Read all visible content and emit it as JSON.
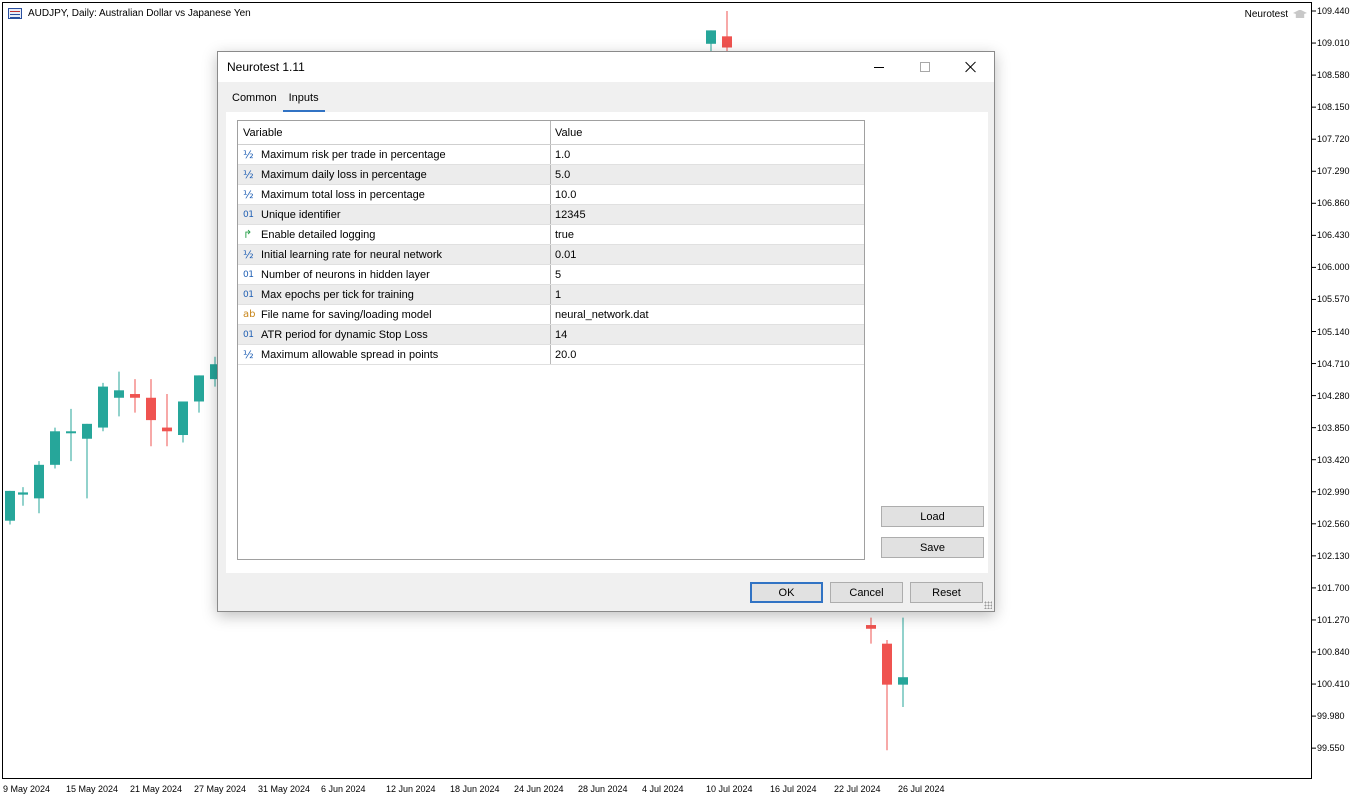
{
  "chart": {
    "title": "AUDJPY, Daily:  Australian Dollar vs Japanese Yen",
    "ea_name": "Neurotest",
    "ea_icon": "graduation-cap-icon",
    "colors": {
      "bull": "#26a69a",
      "bear": "#ef5350",
      "frame": "#000000"
    }
  },
  "chart_data": {
    "type": "candlestick",
    "y_ticks": [
      "109.440",
      "109.010",
      "108.580",
      "108.150",
      "107.720",
      "107.290",
      "106.860",
      "106.430",
      "106.000",
      "105.570",
      "105.140",
      "104.710",
      "104.280",
      "103.850",
      "103.420",
      "102.990",
      "102.560",
      "102.130",
      "101.700",
      "101.270",
      "100.840",
      "100.410",
      "99.980",
      "99.550"
    ],
    "x_ticks": [
      "9 May 2024",
      "15 May 2024",
      "21 May 2024",
      "27 May 2024",
      "31 May 2024",
      "6 Jun 2024",
      "12 Jun 2024",
      "18 Jun 2024",
      "24 Jun 2024",
      "28 Jun 2024",
      "4 Jul 2024",
      "10 Jul 2024",
      "16 Jul 2024",
      "22 Jul 2024",
      "26 Jul 2024"
    ],
    "ylim": [
      99.55,
      109.44
    ],
    "candles": [
      {
        "o": 102.6,
        "h": 103.0,
        "l": 102.55,
        "c": 103.0
      },
      {
        "o": 102.95,
        "h": 103.05,
        "l": 102.8,
        "c": 102.98
      },
      {
        "o": 102.9,
        "h": 103.4,
        "l": 102.7,
        "c": 103.35
      },
      {
        "o": 103.35,
        "h": 103.85,
        "l": 103.3,
        "c": 103.8
      },
      {
        "o": 103.78,
        "h": 104.1,
        "l": 103.4,
        "c": 103.8
      },
      {
        "o": 103.7,
        "h": 103.9,
        "l": 102.9,
        "c": 103.9
      },
      {
        "o": 103.85,
        "h": 104.45,
        "l": 103.8,
        "c": 104.4
      },
      {
        "o": 104.25,
        "h": 104.6,
        "l": 104.0,
        "c": 104.35
      },
      {
        "o": 104.3,
        "h": 104.5,
        "l": 104.05,
        "c": 104.25
      },
      {
        "o": 104.25,
        "h": 104.5,
        "l": 103.6,
        "c": 103.95
      },
      {
        "o": 103.85,
        "h": 104.3,
        "l": 103.6,
        "c": 103.8
      },
      {
        "o": 103.75,
        "h": 104.2,
        "l": 103.65,
        "c": 104.2
      },
      {
        "o": 104.2,
        "h": 104.55,
        "l": 104.05,
        "c": 104.55
      },
      {
        "o": 104.5,
        "h": 104.8,
        "l": 104.4,
        "c": 104.7
      },
      {
        "o": 109.0,
        "h": 109.1,
        "l": 108.85,
        "c": 109.18
      },
      {
        "o": 109.1,
        "h": 109.44,
        "l": 108.9,
        "c": 108.95
      },
      {
        "o": 101.2,
        "h": 101.3,
        "l": 100.95,
        "c": 101.15
      },
      {
        "o": 100.95,
        "h": 101.0,
        "l": 99.52,
        "c": 100.4
      },
      {
        "o": 100.4,
        "h": 101.3,
        "l": 100.1,
        "c": 100.5
      }
    ]
  },
  "dialog": {
    "title": "Neurotest 1.11",
    "tabs": [
      "Common",
      "Inputs"
    ],
    "active_tab": "Inputs",
    "columns": [
      "Variable",
      "Value"
    ],
    "rows": [
      {
        "icon": "double-type-icon",
        "glyph": "½",
        "variable": "Maximum risk per trade in percentage",
        "value": "1.0"
      },
      {
        "icon": "double-type-icon",
        "glyph": "½",
        "variable": "Maximum daily loss in percentage",
        "value": "5.0"
      },
      {
        "icon": "double-type-icon",
        "glyph": "½",
        "variable": "Maximum total loss in percentage",
        "value": "10.0"
      },
      {
        "icon": "integer-type-icon",
        "glyph": "01",
        "variable": "Unique identifier",
        "value": "12345"
      },
      {
        "icon": "bool-type-icon",
        "glyph": "↱",
        "variable": "Enable detailed logging",
        "value": "true"
      },
      {
        "icon": "double-type-icon",
        "glyph": "½",
        "variable": "Initial learning rate for neural network",
        "value": "0.01"
      },
      {
        "icon": "integer-type-icon",
        "glyph": "01",
        "variable": "Number of neurons in hidden layer",
        "value": "5"
      },
      {
        "icon": "integer-type-icon",
        "glyph": "01",
        "variable": "Max epochs per tick for training",
        "value": "1"
      },
      {
        "icon": "string-type-icon",
        "glyph": "ab",
        "variable": "File name for saving/loading model",
        "value": "neural_network.dat"
      },
      {
        "icon": "integer-type-icon",
        "glyph": "01",
        "variable": "ATR period for dynamic Stop Loss",
        "value": "14"
      },
      {
        "icon": "double-type-icon",
        "glyph": "½",
        "variable": "Maximum allowable spread in points",
        "value": "20.0"
      }
    ],
    "buttons": {
      "load": "Load",
      "save": "Save",
      "ok": "OK",
      "cancel": "Cancel",
      "reset": "Reset"
    }
  }
}
